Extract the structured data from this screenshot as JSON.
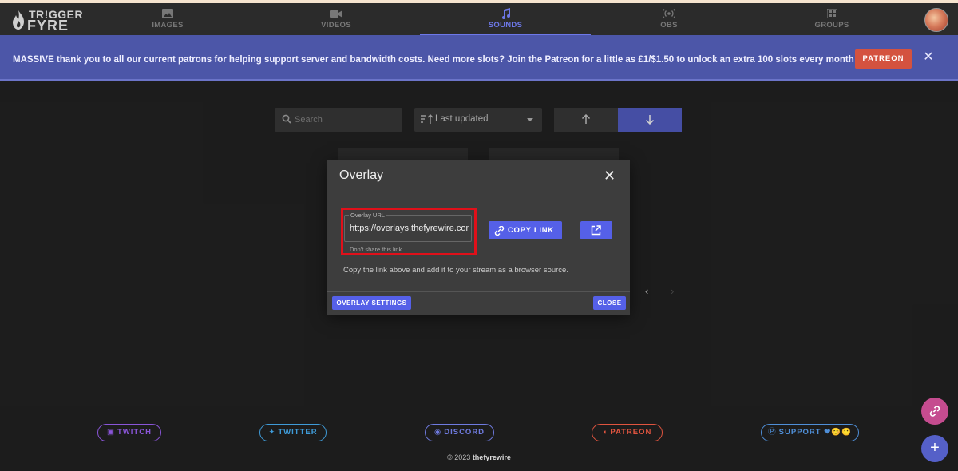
{
  "brand": {
    "line1": "TR!GGER",
    "line2": "FYRE"
  },
  "nav": {
    "items": [
      {
        "label": "IMAGES",
        "icon": "image-icon"
      },
      {
        "label": "VIDEOS",
        "icon": "video-icon"
      },
      {
        "label": "SOUNDS",
        "icon": "music-note-icon",
        "active": true
      },
      {
        "label": "OBS",
        "icon": "broadcast-icon"
      },
      {
        "label": "GROUPS",
        "icon": "grid-icon"
      }
    ]
  },
  "banner": {
    "message": "MASSIVE thank you to all our current patrons for helping support server and bandwidth costs. Need more slots? Join the Patreon for a little as £1/$1.50 to unlock an extra 100 slots every month ❤",
    "button": "PATREON",
    "close": "✕"
  },
  "toolbar": {
    "search_placeholder": "Search",
    "sort_value": "Last updated"
  },
  "pager": {
    "prev": "‹",
    "next": "›"
  },
  "modal": {
    "title": "Overlay",
    "close": "✕",
    "url_label": "Overlay URL",
    "url_value": "https://overlays.thefyrewire.com",
    "helper": "Don't share this link",
    "copy_button": "COPY LINK",
    "hint": "Copy the link above and add it to your stream as a browser source.",
    "settings_button": "OVERLAY SETTINGS",
    "close_button": "CLOSE"
  },
  "footer": {
    "links": [
      {
        "label": "TWITCH",
        "color": "#8a55d8"
      },
      {
        "label": "TWITTER",
        "color": "#3f9bd8"
      },
      {
        "label": "DISCORD",
        "color": "#6f7be0"
      },
      {
        "label": "PATREON",
        "color": "#e0543f"
      },
      {
        "label": "SUPPORT ❤😊🙂",
        "color": "#4f8fd8"
      }
    ],
    "copyright_prefix": "© 2023",
    "copyright_name": "thefyrewire"
  },
  "fab": {
    "add": "+"
  }
}
